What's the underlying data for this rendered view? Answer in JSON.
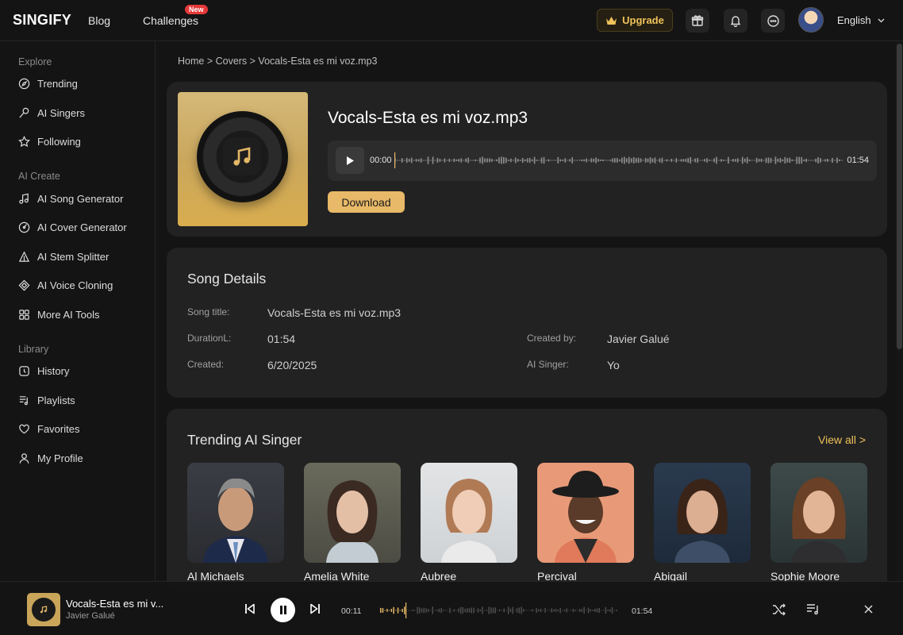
{
  "header": {
    "logo": "SINGIFY",
    "nav": {
      "blog": "Blog",
      "challenges": "Challenges",
      "new_badge": "New"
    },
    "upgrade_label": "Upgrade",
    "language": "English"
  },
  "sidebar": {
    "explore_label": "Explore",
    "explore": [
      "Trending",
      "AI Singers",
      "Following"
    ],
    "create_label": "AI Create",
    "create": [
      "AI Song Generator",
      "AI Cover Generator",
      "AI Stem Splitter",
      "AI Voice Cloning",
      "More AI Tools"
    ],
    "library_label": "Library",
    "library": [
      "History",
      "Playlists",
      "Favorites",
      "My Profile"
    ]
  },
  "breadcrumb": "Home > Covers > Vocals-Esta es mi voz.mp3",
  "song": {
    "title": "Vocals-Esta es mi voz.mp3",
    "time_start": "00:00",
    "time_end": "01:54",
    "download_label": "Download"
  },
  "details": {
    "heading": "Song Details",
    "song_title_label": "Song title:",
    "song_title": "Vocals-Esta es mi voz.mp3",
    "duration_label": "DurationL:",
    "duration": "01:54",
    "created_label": "Created:",
    "created": "6/20/2025",
    "created_by_label": "Created by:",
    "created_by": "Javier Galué",
    "ai_singer_label": "AI Singer:",
    "ai_singer": "Yo"
  },
  "trending": {
    "heading": "Trending AI Singer",
    "view_all": "View all >",
    "singers": [
      "Al Michaels",
      "Amelia White",
      "Aubree",
      "Percival",
      "Abigail",
      "Sophie Moore"
    ]
  },
  "bottom_player": {
    "title": "Vocals-Esta es mi v...",
    "artist": "Javier Galué",
    "current": "00:11",
    "duration": "01:54"
  },
  "colors": {
    "accent": "#e8b968",
    "gold_text": "#f0c25a",
    "badge": "#e5393a",
    "background": "#141414",
    "card": "#222222"
  }
}
